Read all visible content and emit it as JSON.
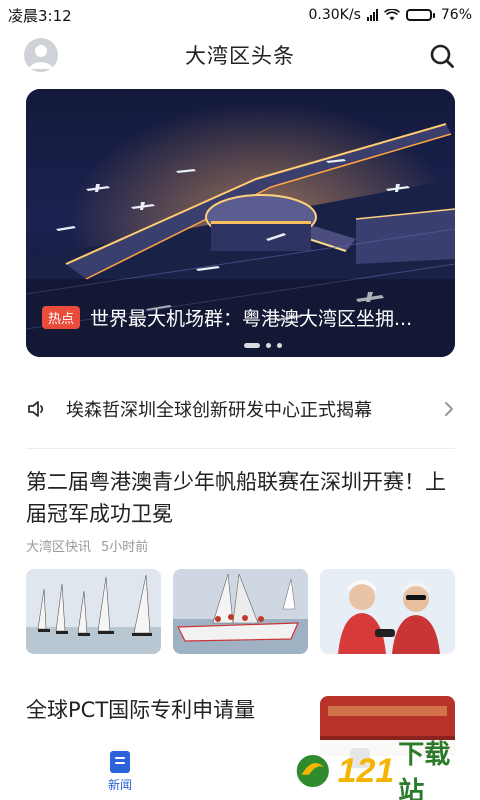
{
  "status_bar": {
    "time": "凌晨3:12",
    "net_speed": "0.30K/s",
    "battery": "76%",
    "battery_level": 0.76
  },
  "header": {
    "title": "大湾区头条",
    "icons": {
      "avatar": "user-avatar",
      "search": "search-icon"
    }
  },
  "banner": {
    "badge": "热点",
    "title": "世界最大机场群：粤港澳大湾区坐拥...",
    "slide_count": 3,
    "active_slide": 1
  },
  "ticker": {
    "text": "埃森哲深圳全球创新研发中心正式揭幕",
    "icons": {
      "speaker": "speaker-icon",
      "chevron": "chevron-right-icon"
    }
  },
  "news_items": [
    {
      "title": "第二届粤港澳青少年帆船联赛在深圳开赛！上届冠军成功卫冕",
      "source": "大湾区快讯",
      "time": "5小时前"
    },
    {
      "title": "全球PCT国际专利申请量"
    }
  ],
  "tabbar": {
    "news_label": "新闻",
    "active_color": "#2a62d8"
  },
  "watermark": {
    "number": "121",
    "text": "下载站"
  },
  "colors": {
    "badge": "#ea4c3c",
    "accent": "#2a62d8"
  }
}
